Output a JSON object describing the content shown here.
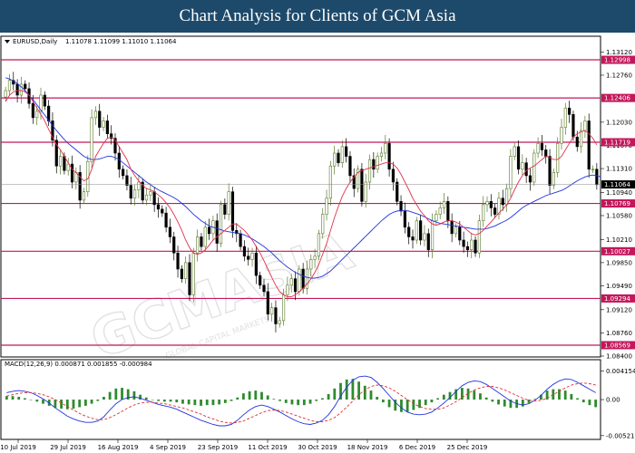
{
  "header": {
    "title": "Chart Analysis for Clients of GCM Asia"
  },
  "watermark": {
    "main": "GCMASIA",
    "sub": "GLOBAL CAPITAL MARKETS"
  },
  "colors": {
    "banner": "#1d4a6b",
    "resistance": "#c2185b",
    "ma_fast": "#e0304a",
    "ma_slow": "#2233dd",
    "macd_line": "#2233dd",
    "signal_line": "#e03030",
    "histogram": "#2e8b2e",
    "candle_up": "#5a7a2a",
    "candle_down": "#000000"
  },
  "chart_data": [
    {
      "type": "candlestick",
      "symbol_label": "EURUSD,Daily",
      "ohlc_label": "1.11078 1.11099 1.11010 1.11064",
      "last_price": "1.11064",
      "ylim": [
        1.084,
        1.1335
      ],
      "y_ticks": [
        "1.13120",
        "1.12760",
        "1.12030",
        "1.11670",
        "1.11310",
        "1.10940",
        "1.10580",
        "1.10210",
        "1.09850",
        "1.09490",
        "1.09120",
        "1.08760",
        "1.08400"
      ],
      "levels": [
        "1.12998",
        "1.12406",
        "1.11719",
        "1.10769",
        "1.10027",
        "1.09294",
        "1.08569"
      ],
      "x_ticks": [
        "10 Jul 2019",
        "29 Jul 2019",
        "16 Aug 2019",
        "4 Sep 2019",
        "23 Sep 2019",
        "11 Oct 2019",
        "30 Oct 2019",
        "18 Nov 2019",
        "6 Dec 2019",
        "25 Dec 2019"
      ],
      "close": [
        1.1252,
        1.1268,
        1.1262,
        1.1245,
        1.1262,
        1.1255,
        1.1232,
        1.121,
        1.122,
        1.1245,
        1.1228,
        1.1205,
        1.1175,
        1.1135,
        1.115,
        1.1128,
        1.1138,
        1.111,
        1.1125,
        1.1082,
        1.1095,
        1.1142,
        1.121,
        1.122,
        1.1195,
        1.1205,
        1.1185,
        1.1178,
        1.1155,
        1.113,
        1.112,
        1.1105,
        1.1085,
        1.1098,
        1.111,
        1.1082,
        1.109,
        1.1095,
        1.1075,
        1.1068,
        1.1062,
        1.104,
        1.1025,
        1.1,
        1.0975,
        1.096,
        1.0985,
        1.0935,
        1.1,
        1.1025,
        1.101,
        1.104,
        1.103,
        1.105,
        1.1015,
        1.1075,
        1.106,
        1.1095,
        1.1035,
        1.103,
        1.101,
        1.0995,
        1.099,
        1.1,
        1.0965,
        1.095,
        1.094,
        1.0905,
        1.0915,
        1.089,
        1.0895,
        1.0935,
        1.095,
        1.096,
        1.094,
        1.0975,
        1.0945,
        1.0975,
        1.099,
        1.0995,
        1.103,
        1.106,
        1.1085,
        1.1135,
        1.1155,
        1.114,
        1.1165,
        1.115,
        1.112,
        1.11,
        1.113,
        1.108,
        1.111,
        1.1145,
        1.113,
        1.115,
        1.1155,
        1.117,
        1.113,
        1.111,
        1.108,
        1.1065,
        1.104,
        1.1025,
        1.102,
        1.105,
        1.102,
        1.103,
        1.1005,
        1.105,
        1.106,
        1.107,
        1.108,
        1.105,
        1.103,
        1.104,
        1.102,
        1.101,
        1.1005,
        1.102,
        1.1,
        1.105,
        1.1075,
        1.108,
        1.107,
        1.106,
        1.1085,
        1.1075,
        1.11,
        1.115,
        1.1165,
        1.113,
        1.114,
        1.112,
        1.111,
        1.1155,
        1.117,
        1.116,
        1.115,
        1.1105,
        1.1125,
        1.117,
        1.1195,
        1.1225,
        1.1215,
        1.118,
        1.1165,
        1.119,
        1.1205,
        1.113,
        1.113,
        1.1106
      ],
      "ma_fast": [
        1.1235,
        1.1245,
        1.125,
        1.1252,
        1.1252,
        1.125,
        1.1245,
        1.1235,
        1.1225,
        1.1215,
        1.1205,
        1.1192,
        1.118,
        1.1168,
        1.116,
        1.115,
        1.114,
        1.113,
        1.1125,
        1.1118,
        1.1112,
        1.1115,
        1.113,
        1.115,
        1.116,
        1.117,
        1.1178,
        1.118,
        1.1175,
        1.1165,
        1.1155,
        1.1145,
        1.113,
        1.112,
        1.1112,
        1.1105,
        1.11,
        1.1098,
        1.1095,
        1.109,
        1.1085,
        1.1078,
        1.107,
        1.106,
        1.1048,
        1.1035,
        1.102,
        1.1008,
        1.1,
        1.0998,
        1.1,
        1.1005,
        1.1012,
        1.102,
        1.1025,
        1.103,
        1.1035,
        1.104,
        1.1045,
        1.1045,
        1.104,
        1.1035,
        1.1028,
        1.102,
        1.101,
        1.1,
        1.0988,
        1.0975,
        1.0962,
        1.095,
        1.094,
        1.0935,
        1.0932,
        1.0932,
        1.0935,
        1.094,
        1.0945,
        1.0952,
        1.096,
        1.097,
        1.0982,
        1.0998,
        1.1015,
        1.1035,
        1.1055,
        1.1072,
        1.1088,
        1.11,
        1.111,
        1.1118,
        1.1125,
        1.1128,
        1.113,
        1.1132,
        1.1134,
        1.1136,
        1.1138,
        1.114,
        1.114,
        1.1138,
        1.1132,
        1.1122,
        1.111,
        1.1098,
        1.1085,
        1.1075,
        1.1065,
        1.1058,
        1.105,
        1.1045,
        1.1043,
        1.1045,
        1.1048,
        1.105,
        1.105,
        1.1048,
        1.1045,
        1.104,
        1.1035,
        1.103,
        1.1028,
        1.103,
        1.1035,
        1.1042,
        1.1048,
        1.1055,
        1.1062,
        1.1068,
        1.1075,
        1.1085,
        1.1098,
        1.111,
        1.112,
        1.1128,
        1.1132,
        1.1135,
        1.114,
        1.1145,
        1.115,
        1.1148,
        1.1145,
        1.1145,
        1.115,
        1.116,
        1.117,
        1.118,
        1.1185,
        1.1188,
        1.119,
        1.1185,
        1.1178,
        1.1168
      ],
      "ma_slow": [
        1.1272,
        1.127,
        1.1267,
        1.1263,
        1.1258,
        1.1252,
        1.1245,
        1.1238,
        1.123,
        1.1222,
        1.1214,
        1.1206,
        1.1198,
        1.119,
        1.1183,
        1.1176,
        1.117,
        1.1165,
        1.116,
        1.1155,
        1.115,
        1.1147,
        1.1145,
        1.1145,
        1.1146,
        1.1148,
        1.115,
        1.115,
        1.1148,
        1.1145,
        1.114,
        1.1135,
        1.113,
        1.1125,
        1.112,
        1.1115,
        1.111,
        1.1106,
        1.1102,
        1.1098,
        1.1095,
        1.1092,
        1.1089,
        1.1086,
        1.1082,
        1.1077,
        1.1072,
        1.1066,
        1.106,
        1.1055,
        1.105,
        1.1046,
        1.1042,
        1.104,
        1.1038,
        1.1036,
        1.1034,
        1.1033,
        1.1032,
        1.1031,
        1.103,
        1.1028,
        1.1025,
        1.1022,
        1.1018,
        1.1014,
        1.101,
        1.1005,
        1.1,
        1.0994,
        1.0988,
        1.0983,
        1.0978,
        1.0974,
        1.097,
        1.0967,
        1.0964,
        1.0962,
        1.0961,
        1.0961,
        1.0962,
        1.0964,
        1.0968,
        1.0972,
        1.0978,
        1.0984,
        1.099,
        1.0996,
        1.1002,
        1.1008,
        1.1014,
        1.102,
        1.1026,
        1.1032,
        1.1038,
        1.1044,
        1.105,
        1.1055,
        1.106,
        1.1063,
        1.1065,
        1.1066,
        1.1066,
        1.1065,
        1.1063,
        1.1061,
        1.1059,
        1.1056,
        1.1053,
        1.105,
        1.1048,
        1.1046,
        1.1045,
        1.1044,
        1.1043,
        1.1042,
        1.1041,
        1.104,
        1.1039,
        1.1038,
        1.1037,
        1.1037,
        1.1037,
        1.1038,
        1.104,
        1.1042,
        1.1045,
        1.1048,
        1.1051,
        1.1055,
        1.106,
        1.1065,
        1.107,
        1.1074,
        1.1077,
        1.108,
        1.1083,
        1.1086,
        1.1089,
        1.1091,
        1.1093,
        1.1095,
        1.1097,
        1.11,
        1.1104,
        1.1108,
        1.1112,
        1.1115,
        1.1118,
        1.112,
        1.1121,
        1.112,
        1.1118
      ]
    },
    {
      "type": "line",
      "indicator_label": "MACD(12,26,9) 0.000871 0.001855 -0.000984",
      "ylim": [
        -0.0055,
        0.0042
      ],
      "y_ticks": [
        "0.004154",
        "0.00",
        "-0.005217"
      ],
      "series": [
        {
          "name": "MACD",
          "values": [
            0.001,
            0.0012,
            0.0013,
            0.0012,
            0.001,
            0.0006,
            0.0001,
            -0.0005,
            -0.0012,
            -0.0018,
            -0.0024,
            -0.0028,
            -0.0031,
            -0.0033,
            -0.0033,
            -0.0031,
            -0.0025,
            -0.0015,
            -0.0006,
            0.0,
            0.0003,
            0.0004,
            0.0002,
            -0.0001,
            -0.0004,
            -0.0007,
            -0.0009,
            -0.0011,
            -0.0014,
            -0.0018,
            -0.0022,
            -0.0026,
            -0.003,
            -0.0033,
            -0.0036,
            -0.0038,
            -0.0038,
            -0.0036,
            -0.003,
            -0.0022,
            -0.0015,
            -0.001,
            -0.0008,
            -0.001,
            -0.0014,
            -0.0018,
            -0.0023,
            -0.0028,
            -0.0032,
            -0.0035,
            -0.0036,
            -0.0034,
            -0.003,
            -0.0022,
            -0.001,
            0.0005,
            0.0018,
            0.0028,
            0.0033,
            0.0034,
            0.0032,
            0.0025,
            0.0016,
            0.0006,
            -0.0004,
            -0.0012,
            -0.0018,
            -0.0021,
            -0.0022,
            -0.0021,
            -0.0018,
            -0.0012,
            -0.0005,
            0.0003,
            0.0012,
            0.002,
            0.0025,
            0.0027,
            0.0026,
            0.0022,
            0.0016,
            0.001,
            0.0004,
            -0.0002,
            -0.0006,
            -0.0008,
            -0.0006,
            -0.0001,
            0.0006,
            0.0015,
            0.0022,
            0.0027,
            0.003,
            0.0029,
            0.0025,
            0.002,
            0.0015,
            0.001
          ]
        },
        {
          "name": "Signal",
          "values": [
            0.0005,
            0.0007,
            0.0009,
            0.001,
            0.001,
            0.0009,
            0.0007,
            0.0004,
            0.0,
            -0.0005,
            -0.001,
            -0.0015,
            -0.002,
            -0.0024,
            -0.0027,
            -0.0029,
            -0.0029,
            -0.0026,
            -0.0022,
            -0.0017,
            -0.0012,
            -0.0008,
            -0.0005,
            -0.0004,
            -0.0004,
            -0.0005,
            -0.0006,
            -0.0008,
            -0.001,
            -0.0012,
            -0.0015,
            -0.0018,
            -0.0021,
            -0.0025,
            -0.0028,
            -0.0031,
            -0.0033,
            -0.0034,
            -0.0033,
            -0.0031,
            -0.0027,
            -0.0023,
            -0.0019,
            -0.0016,
            -0.0015,
            -0.0016,
            -0.0018,
            -0.0021,
            -0.0024,
            -0.0027,
            -0.003,
            -0.0032,
            -0.0032,
            -0.003,
            -0.0026,
            -0.0019,
            -0.0011,
            -0.0002,
            0.0007,
            0.0014,
            0.0019,
            0.0021,
            0.002,
            0.0017,
            0.0012,
            0.0006,
            0.0,
            -0.0006,
            -0.001,
            -0.0013,
            -0.0014,
            -0.0014,
            -0.0012,
            -0.0008,
            -0.0003,
            0.0003,
            0.0009,
            0.0014,
            0.0017,
            0.0019,
            0.0019,
            0.0017,
            0.0014,
            0.001,
            0.0006,
            0.0002,
            -0.0001,
            -0.0002,
            -0.0001,
            0.0002,
            0.0007,
            0.0012,
            0.0017,
            0.0021,
            0.0023,
            0.0024,
            0.0023,
            0.0021
          ]
        }
      ]
    }
  ]
}
